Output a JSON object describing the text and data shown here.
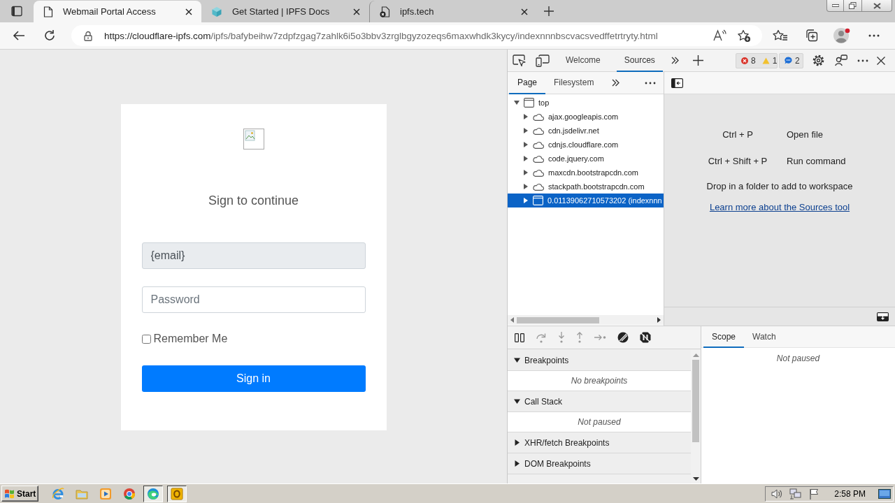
{
  "browser": {
    "tabs": [
      {
        "title": "Webmail Portal Access",
        "kind": "page",
        "selected": true
      },
      {
        "title": "Get Started | IPFS Docs",
        "kind": "cube",
        "selected": false
      },
      {
        "title": "ipfs.tech",
        "kind": "page-error",
        "selected": false
      }
    ],
    "address_bar": {
      "host": "https://cloudflare-ipfs.com",
      "path": "/ipfs/bafybeihw7zdpfzgag7zahlk6i5o3bbv3zrglbgyzozeqs6maxwhdk3kycy/indexnnnbscvacsvedffetrtryty.html"
    }
  },
  "page": {
    "heading": "Sign to continue",
    "email": {
      "value": "{email}",
      "disabled": true
    },
    "password": {
      "placeholder": "Password"
    },
    "remember_me": {
      "label": "Remember Me",
      "checked": false
    },
    "submit": "Sign in"
  },
  "devtools": {
    "tabs": [
      {
        "label": "Welcome",
        "selected": false
      },
      {
        "label": "Sources",
        "selected": true
      }
    ],
    "counts": {
      "errors": "8",
      "warnings": "1",
      "messages": "2"
    },
    "navigator": {
      "tabs": [
        {
          "label": "Page",
          "selected": true
        },
        {
          "label": "Filesystem",
          "selected": false
        }
      ],
      "tree": [
        {
          "label": "top",
          "kind": "frame",
          "expanded": true,
          "selected": false,
          "children": [
            {
              "label": "ajax.googleapis.com",
              "kind": "domain",
              "expanded": false,
              "selected": false
            },
            {
              "label": "cdn.jsdelivr.net",
              "kind": "domain",
              "expanded": false,
              "selected": false
            },
            {
              "label": "cdnjs.cloudflare.com",
              "kind": "domain",
              "expanded": false,
              "selected": false
            },
            {
              "label": "code.jquery.com",
              "kind": "domain",
              "expanded": false,
              "selected": false
            },
            {
              "label": "maxcdn.bootstrapcdn.com",
              "kind": "domain",
              "expanded": false,
              "selected": false
            },
            {
              "label": "stackpath.bootstrapcdn.com",
              "kind": "domain",
              "expanded": false,
              "selected": false
            },
            {
              "label": "0.01139062710573202 (indexnnn",
              "kind": "frame",
              "expanded": false,
              "selected": true
            }
          ]
        }
      ]
    },
    "editor": {
      "shortcuts": [
        {
          "keys": "Ctrl + P",
          "action": "Open file"
        },
        {
          "keys": "Ctrl + Shift + P",
          "action": "Run command"
        }
      ],
      "drop_hint": "Drop in a folder to add to workspace",
      "link": "Learn more about the Sources tool"
    },
    "debugger": {
      "controls": [
        {
          "kind": "pause",
          "disabled": false
        },
        {
          "kind": "step-over",
          "disabled": true
        },
        {
          "kind": "step-into",
          "disabled": true
        },
        {
          "kind": "step-out",
          "disabled": true
        },
        {
          "kind": "step",
          "disabled": true
        },
        {
          "kind": "deactivate",
          "disabled": false
        },
        {
          "kind": "pause-exceptions",
          "disabled": false
        }
      ],
      "sections": [
        {
          "title": "Breakpoints",
          "expanded": true,
          "message": "No breakpoints"
        },
        {
          "title": "Call Stack",
          "expanded": true,
          "message": "Not paused"
        },
        {
          "title": "XHR/fetch Breakpoints",
          "expanded": false
        },
        {
          "title": "DOM Breakpoints",
          "expanded": false
        }
      ]
    },
    "sidebar": {
      "tabs": [
        {
          "label": "Scope",
          "selected": true
        },
        {
          "label": "Watch",
          "selected": false
        }
      ],
      "message": "Not paused"
    }
  },
  "taskbar": {
    "start": "Start",
    "apps": [
      {
        "kind": "e-logo",
        "selected": false
      },
      {
        "kind": "folder",
        "selected": false
      },
      {
        "kind": "media",
        "selected": false
      },
      {
        "kind": "circle-logo",
        "selected": false
      },
      {
        "kind": "swirl-logo",
        "selected": true
      },
      {
        "kind": "ring-tile",
        "selected": true
      }
    ],
    "clock": "2:58 PM"
  }
}
